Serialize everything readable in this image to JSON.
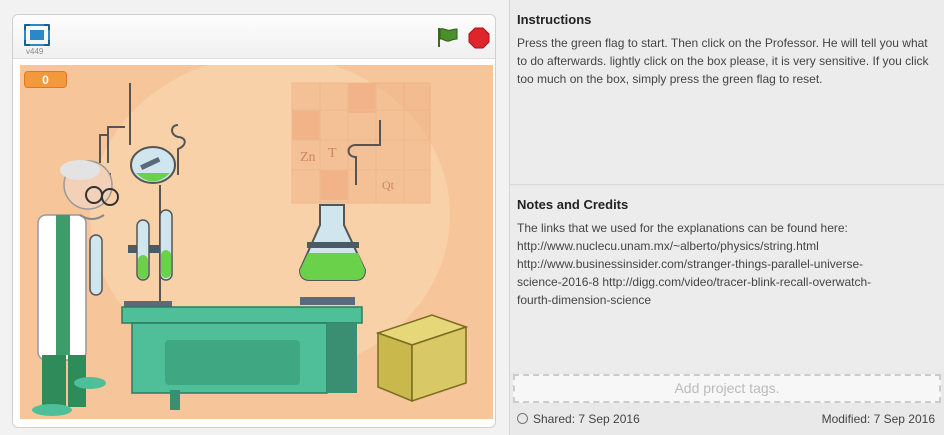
{
  "player": {
    "version": "v449",
    "counter_value": "0",
    "stage": {
      "wall_glyphs": [
        "Zn",
        "T",
        "Qt"
      ]
    }
  },
  "instructions": {
    "heading": "Instructions",
    "text": "Press the green flag to start. Then click on the Professor. He will tell you what to do afterwards. lightly click on the box please, it is very sensitive. If you click too much on the box, simply press the green flag to reset."
  },
  "notes": {
    "heading": "Notes and Credits",
    "text": "The links that we used for the explanations can be found here:\nhttp://www.nuclecu.unam.mx/~alberto/physics/string.html\nhttp://www.businessinsider.com/stranger-things-parallel-universe-\nscience-2016-8 http://digg.com/video/tracer-blink-recall-overwatch-\nfourth-dimension-science"
  },
  "tags": {
    "placeholder": "Add project tags."
  },
  "footer": {
    "shared": "Shared: 7 Sep 2016",
    "modified": "Modified: 7 Sep 2016"
  },
  "colors": {
    "flag_green": "#4a8f2a",
    "stop_red": "#e0242b",
    "counter_orange": "#f29a3b",
    "stage_bg": "#f6c59a"
  },
  "icons": [
    "fullscreen-icon",
    "green-flag-icon",
    "stop-icon",
    "share-icon"
  ]
}
